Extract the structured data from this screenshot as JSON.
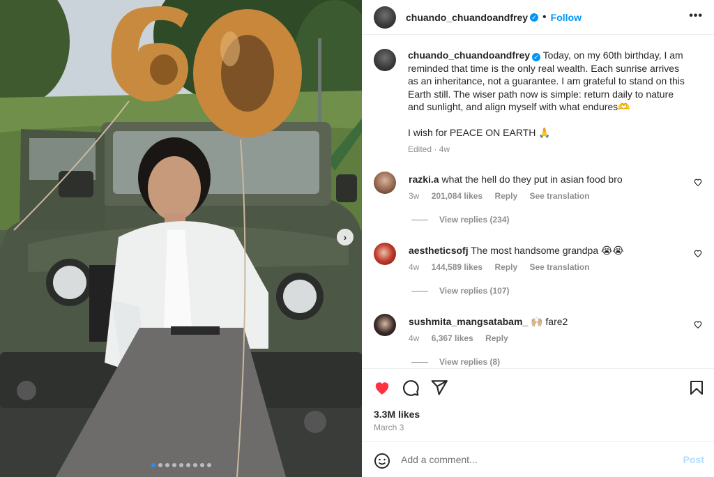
{
  "post": {
    "username": "chuando_chuandoandfrey",
    "follow_label": "Follow",
    "separator": "•",
    "more_label": "•••",
    "caption_line1": "Today, on my 60th birthday, I am reminded that time is the only real wealth. Each sunrise arrives as an inheritance, not a guarantee. I am grateful to stand on this Earth still. The wiser path now is simple: return daily to nature and sunlight, and align myself with what endures🫶",
    "caption_line2": "I wish for PEACE ON EARTH 🙏",
    "caption_meta": "Edited · 4w",
    "balloon_text": "60",
    "carousel_next": "›",
    "carousel_count": 9,
    "carousel_active": 1
  },
  "comments": [
    {
      "username": "razki.a",
      "text": "what the hell do they put in asian food bro",
      "age": "3w",
      "likes": "201,084 likes",
      "reply": "Reply",
      "translate": "See translation",
      "replies": "View replies (234)"
    },
    {
      "username": "aestheticsofj",
      "text": "The most handsome grandpa 😭😭",
      "age": "4w",
      "likes": "144,589 likes",
      "reply": "Reply",
      "translate": "See translation",
      "replies": "View replies (107)"
    },
    {
      "username": "sushmita_mangsatabam_",
      "text": "🙌🏼 fare2",
      "age": "4w",
      "likes": "6,367 likes",
      "reply": "Reply",
      "translate": "",
      "replies": "View replies (8)"
    }
  ],
  "actions": {
    "like_icon": "heart-filled-icon",
    "comment_icon": "comment-icon",
    "share_icon": "share-icon",
    "save_icon": "bookmark-icon",
    "likes": "3.3M likes",
    "date": "March 3"
  },
  "composer": {
    "placeholder": "Add a comment...",
    "post_label": "Post",
    "emoji_icon": "emoji-icon"
  },
  "colors": {
    "accent": "#0095f6",
    "like_red": "#ff3040",
    "muted": "#8e8e8e"
  }
}
